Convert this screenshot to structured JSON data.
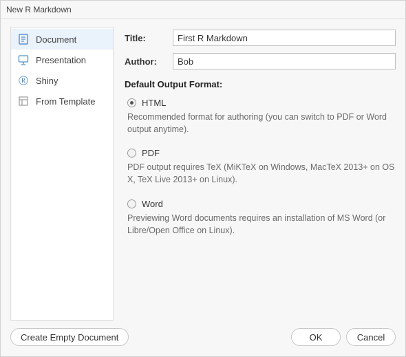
{
  "window": {
    "title": "New R Markdown"
  },
  "sidebar": {
    "items": [
      {
        "label": "Document",
        "icon": "document-icon",
        "selected": true
      },
      {
        "label": "Presentation",
        "icon": "presentation-icon",
        "selected": false
      },
      {
        "label": "Shiny",
        "icon": "shiny-icon",
        "selected": false
      },
      {
        "label": "From Template",
        "icon": "template-icon",
        "selected": false
      }
    ]
  },
  "form": {
    "title_label": "Title:",
    "title_value": "First R Markdown",
    "author_label": "Author:",
    "author_value": "Bob"
  },
  "output": {
    "heading": "Default Output Format:",
    "options": [
      {
        "label": "HTML",
        "checked": true,
        "description": "Recommended format for authoring (you can switch to PDF or Word output anytime)."
      },
      {
        "label": "PDF",
        "checked": false,
        "description": "PDF output requires TeX (MiKTeX on Windows, MacTeX 2013+ on OS X, TeX Live 2013+ on Linux)."
      },
      {
        "label": "Word",
        "checked": false,
        "description": "Previewing Word documents requires an installation of MS Word (or Libre/Open Office on Linux)."
      }
    ]
  },
  "footer": {
    "create_empty": "Create Empty Document",
    "ok": "OK",
    "cancel": "Cancel"
  }
}
